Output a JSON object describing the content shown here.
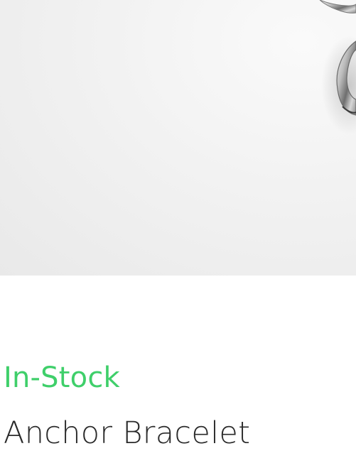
{
  "product": {
    "image_icon": "bracelet-photo",
    "stock_status": "In-Stock",
    "name": "Anchor Bracelet"
  },
  "colors": {
    "in_stock": "#3fcf6a",
    "text": "#2a2a2a",
    "image_bg": "#eeeeee"
  }
}
